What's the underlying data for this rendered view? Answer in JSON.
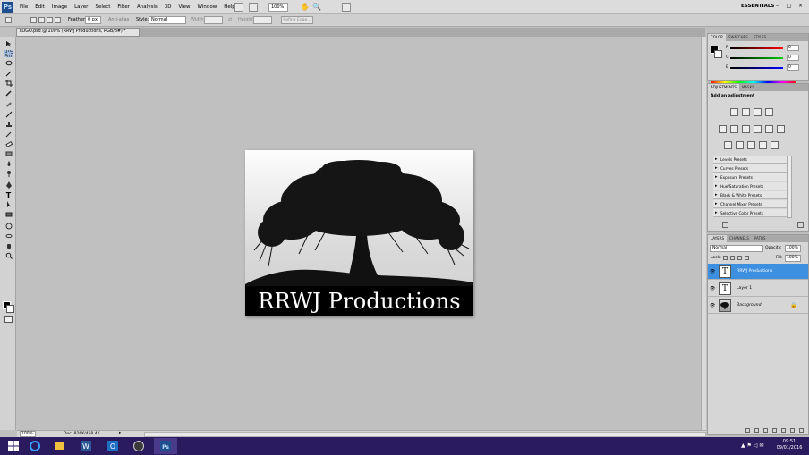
{
  "menubar": {
    "logo": "Ps",
    "menus": [
      "File",
      "Edit",
      "Image",
      "Layer",
      "Select",
      "Filter",
      "Analysis",
      "3D",
      "View",
      "Window",
      "Help"
    ],
    "zoom": "100%",
    "workspace": "ESSENTIALS",
    "window_controls": [
      "–",
      "□",
      "×"
    ]
  },
  "options": {
    "feather_label": "Feather:",
    "feather_value": "0 px",
    "antialias_label": "Anti-alias",
    "style_label": "Style:",
    "style_value": "Normal",
    "width_label": "Width:",
    "height_label": "Height:",
    "refine_edge": "Refine Edge..."
  },
  "document": {
    "tab": "LOGO.psd @ 100% (RRWJ Productions, RGB/8#) *",
    "banner_text": "RRWJ Productions"
  },
  "status": {
    "zoom": "100%",
    "doc": "Doc: 826K/458.4K",
    "arrow": "▸"
  },
  "panels": {
    "color": {
      "tabs": [
        "COLOR",
        "SWATCHES",
        "STYLES"
      ],
      "channels": [
        {
          "label": "R",
          "value": "0"
        },
        {
          "label": "G",
          "value": "0"
        },
        {
          "label": "B",
          "value": "0"
        }
      ]
    },
    "adjustments": {
      "tabs": [
        "ADJUSTMENTS",
        "MASKS"
      ],
      "heading": "Add an adjustment",
      "presets": [
        "Levels Presets",
        "Curves Presets",
        "Exposure Presets",
        "Hue/Saturation Presets",
        "Black & White Presets",
        "Channel Mixer Presets",
        "Selective Color Presets"
      ]
    },
    "layers": {
      "tabs": [
        "LAYERS",
        "CHANNELS",
        "PATHS"
      ],
      "blend_mode": "Normal",
      "opacity_label": "Opacity:",
      "opacity_value": "100%",
      "lock_label": "Lock:",
      "fill_label": "Fill:",
      "fill_value": "100%",
      "items": [
        {
          "name": "RRWJ Productions",
          "thumb": "T",
          "selected": true
        },
        {
          "name": "Layer 1",
          "thumb": "T",
          "selected": false
        },
        {
          "name": "Background",
          "thumb": "",
          "selected": false
        }
      ]
    }
  },
  "taskbar": {
    "time": "09:51",
    "date": "09/01/2016",
    "apps": [
      "start",
      "internet-explorer",
      "file-explorer",
      "word",
      "outlook",
      "media",
      "photoshop"
    ]
  },
  "colors": {
    "layer_selected": "#3d8fe0",
    "taskbar": "#2a1a5e",
    "canvas_bg": "#c0c0c0"
  }
}
